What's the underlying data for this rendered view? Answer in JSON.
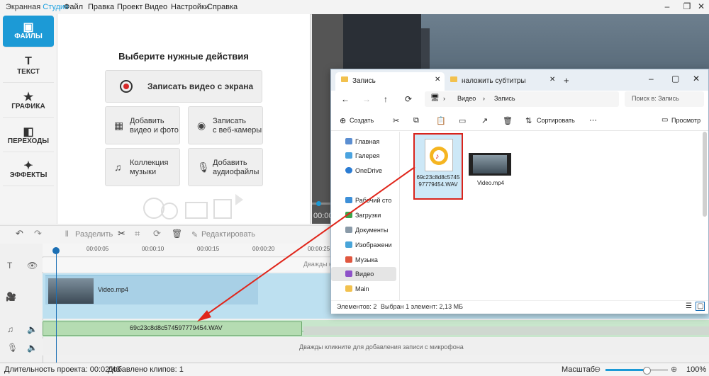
{
  "app": {
    "name_main": "Экранная",
    "name_accent": "Студия",
    "menu": [
      "Файл",
      "Правка",
      "Проект",
      "Видео",
      "Настройки",
      "Справка"
    ]
  },
  "nav": {
    "files": "ФАЙЛЫ",
    "text": "ТЕКСТ",
    "graphics": "ГРАФИКА",
    "transitions": "ПЕРЕХОДЫ",
    "effects": "ЭФФЕКТЫ"
  },
  "panel": {
    "title": "Выберите нужные действия",
    "record_screen": "Записать видео с экрана",
    "add_video_line1": "Добавить",
    "add_video_line2": "видео и фото",
    "webcam_line1": "Записать",
    "webcam_line2": "с веб-камеры",
    "music_line1": "Коллекция",
    "music_line2": "музыки",
    "audio_line1": "Добавить",
    "audio_line2": "аудиофайлы"
  },
  "preview": {
    "time": "00:00"
  },
  "toolbar": {
    "split": "Разделить",
    "edit": "Редактировать"
  },
  "timeline": {
    "ticks": [
      "00:00:05",
      "00:00:10",
      "00:00:15",
      "00:00:20",
      "00:00:25"
    ],
    "text_hint": "Дважды кликн",
    "video_clip": "Video.mp4",
    "audio_clip": "69c23c8d8c574597779454.WAV",
    "mic_hint": "Дважды кликните для добавления записи с микрофона"
  },
  "status": {
    "duration": "Длительность проекта: 00:02:43",
    "clips": "Добавлено клипов: 1",
    "zoom_label": "Масштаб:",
    "zoom_value": "100%",
    "zoom_level": 0.66
  },
  "explorer": {
    "tab_active": "Запись",
    "tab_other": "наложить субтитры",
    "path_video": "Видео",
    "path_record": "Запись",
    "search": "Поиск в: Запись",
    "create": "Создать",
    "sort": "Сортировать",
    "view": "Просмотр",
    "sidebar": [
      "Главная",
      "Галерея",
      "OneDrive",
      "Рабочий сто",
      "Загрузки",
      "Документы",
      "Изображени",
      "Музыка",
      "Видео",
      "Main"
    ],
    "file_wav_line1": "69c23c8d8c5745",
    "file_wav_line2": "97779454.WAV",
    "file_mp4": "Video.mp4",
    "status_count": "Элементов: 2",
    "status_selected": "Выбран 1 элемент: 2,13 МБ"
  },
  "colors": {
    "accent": "#1c9ad6",
    "arrow": "#e0261b",
    "audio_track": "#c8e6cc",
    "video_track": "#bde0f0"
  }
}
